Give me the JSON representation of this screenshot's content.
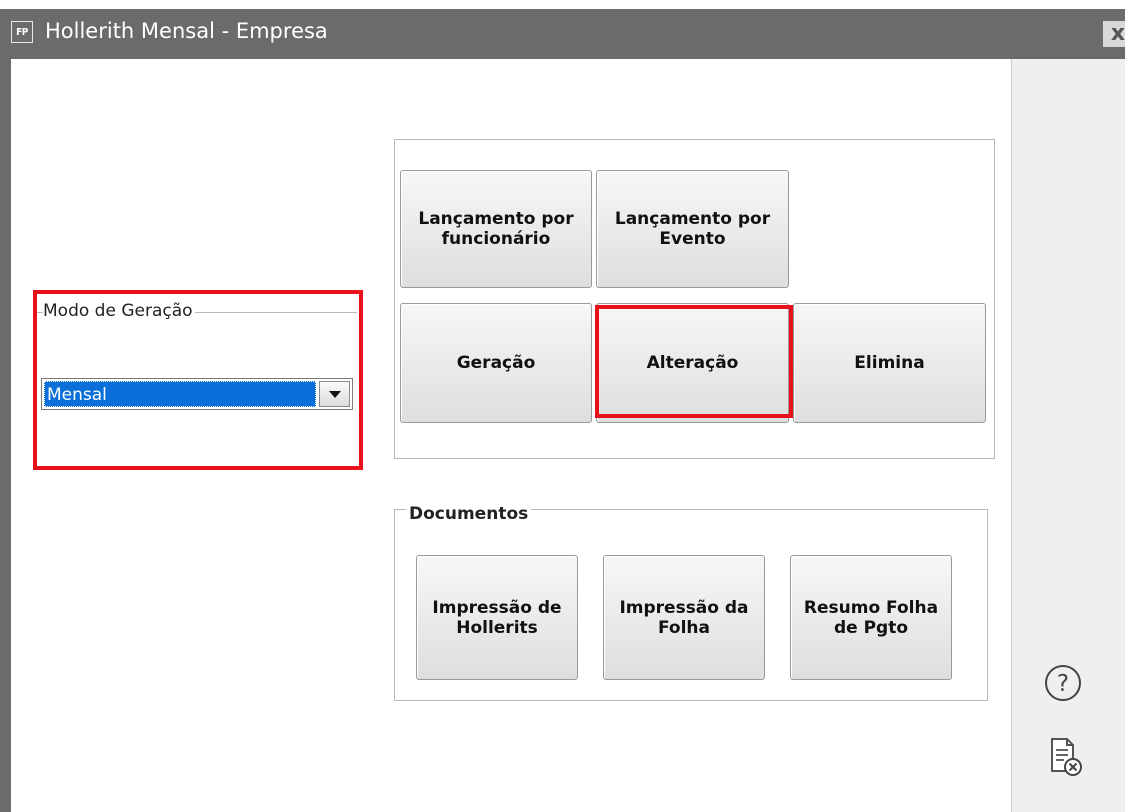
{
  "window": {
    "app_icon_text": "FP",
    "title": "Hollerith Mensal - Empresa",
    "close_label": "x"
  },
  "modo": {
    "legend": "Modo de Geração",
    "selected": "Mensal"
  },
  "actions": {
    "lanc_funcionario": "Lançamento por\nfuncionário",
    "lanc_evento": "Lançamento por\nEvento",
    "geracao": "Geração",
    "alteracao": "Alteração",
    "elimina": "Elimina"
  },
  "documentos": {
    "legend": "Documentos",
    "impressao_hollerits": "Impressão de\nHollerits",
    "impressao_folha": "Impressão da\nFolha",
    "resumo_folha": "Resumo Folha\nde Pgto"
  },
  "side_icons": [
    "help-icon",
    "report-cancel-icon"
  ],
  "colors": {
    "highlight": "#e8111b",
    "selection": "#0a6fd8",
    "titlebar": "#6b6b6b"
  }
}
